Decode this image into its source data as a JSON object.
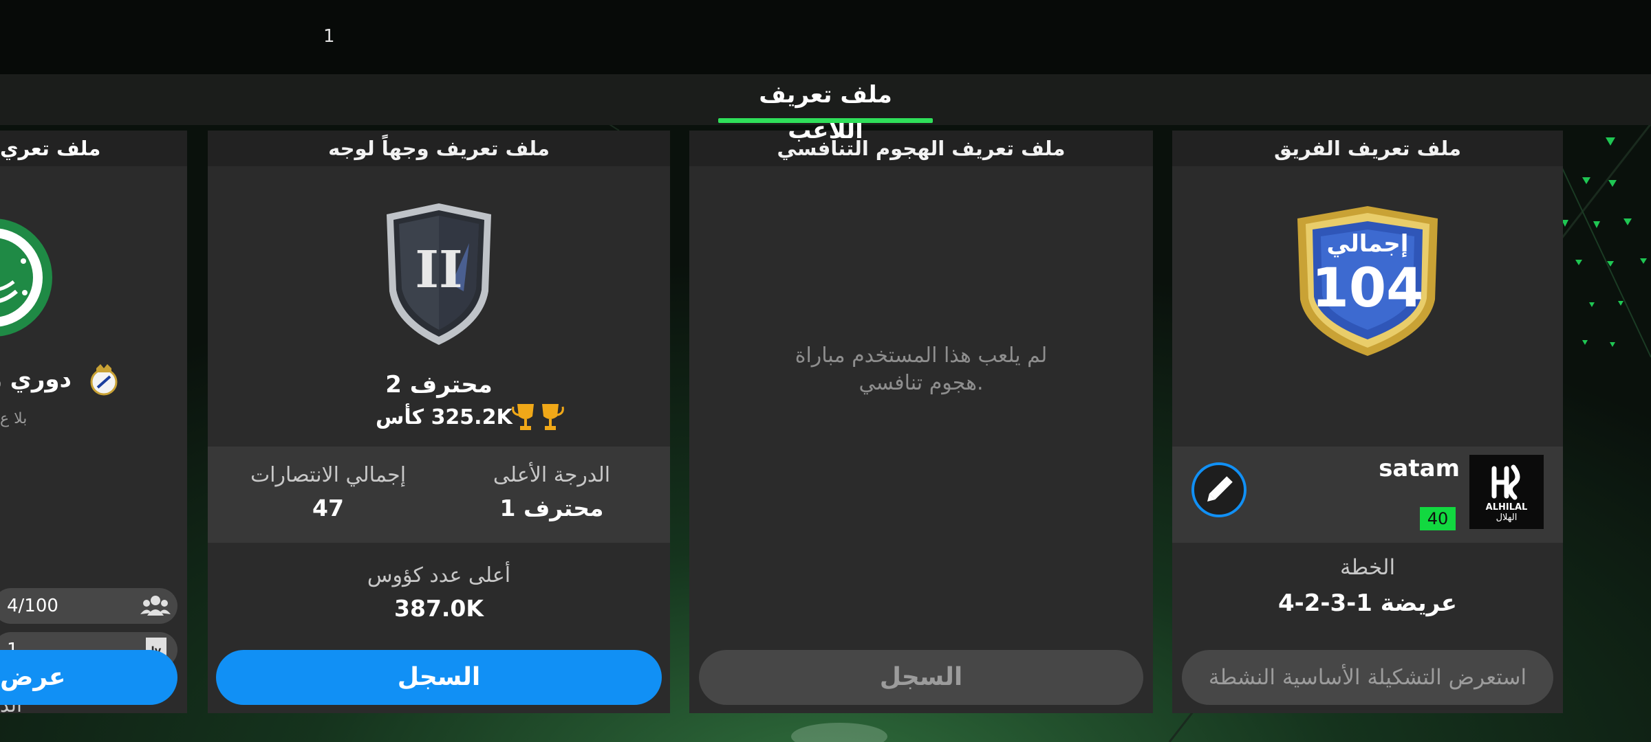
{
  "header": {
    "badge_count": "1",
    "username": "satam",
    "page_title": "ملف تعريف اللاعب"
  },
  "team_profile": {
    "title": "ملف تعريف الفريق",
    "badge_label": "إجمالي",
    "badge_value": "104",
    "team_name": "satam",
    "club_text_top": "ALHILAL",
    "club_text_bottom": "الهلال",
    "level": "40",
    "formation_label": "الخطة",
    "formation_value": "4-2-3-1 عريضة",
    "view_lineup_button": "استعرض التشكيلة الأساسية النشطة"
  },
  "vsa_profile": {
    "title": "ملف تعريف الهجوم التنافسي",
    "empty_line1": "لم يلعب هذا المستخدم مباراة",
    "empty_line2": "هجوم تنافسي.",
    "history_button": "السجل"
  },
  "h2h_profile": {
    "title": "ملف تعريف وجهاً لوجه",
    "rank_numeral": "II",
    "division": "محترف 2",
    "trophies": "325.2K كأس",
    "best_rank_label": "الدرجة الأعلى",
    "best_rank_value": "محترف 1",
    "total_wins_label": "إجمالي الانتصارات",
    "total_wins_value": "47",
    "max_trophies_label": "أعلى عدد كؤوس",
    "max_trophies_value": "387.0K",
    "history_button": "السجل"
  },
  "league_profile": {
    "title_partial": "ملف تعري",
    "league_name_partial": "دوري ر",
    "league_sub_partial": "بلا ع",
    "members": "4/100",
    "level": "1",
    "level_badge": "lv",
    "label_partial": "الد",
    "value_partial": "ب",
    "view_button_partial": "عرض"
  },
  "colors": {
    "accent_blue": "#1190f5",
    "accent_green": "#2fe05a",
    "level_green": "#12d840",
    "card_bg": "#2b2b2b",
    "topbar_bg": "#070a08",
    "trophy_gold": "#f0a818"
  }
}
